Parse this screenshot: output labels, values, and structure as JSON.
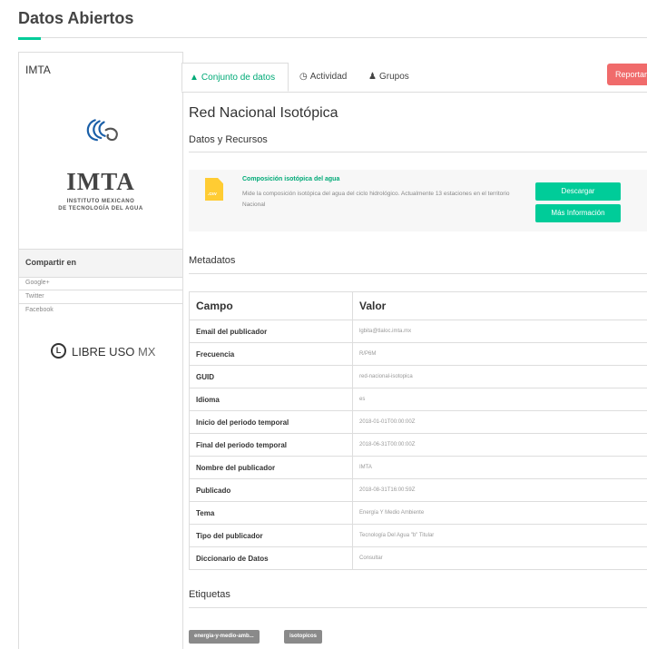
{
  "header": {
    "title": "Datos Abiertos"
  },
  "sidebar": {
    "org_name": "IMTA",
    "logo_text": "IMTA",
    "logo_subtitle_line1": "INSTITUTO MEXICANO",
    "logo_subtitle_line2": "DE TECNOLOGÍA DEL AGUA",
    "share_title": "Compartir en",
    "share_items": [
      "Google+",
      "Twitter",
      "Facebook"
    ],
    "libre_logo_letter": "L",
    "libre_logo_bold": "LIBRE USO",
    "libre_logo_light": " MX"
  },
  "tabs": [
    {
      "label": "Conjunto de datos",
      "icon": "sitemap-icon",
      "active": true
    },
    {
      "label": "Actividad",
      "icon": "clock-icon",
      "active": false
    },
    {
      "label": "Grupos",
      "icon": "users-icon",
      "active": false
    }
  ],
  "report_label": "Reportar",
  "dataset": {
    "title": "Red Nacional Isotópica",
    "resources_heading": "Datos y Recursos",
    "resource": {
      "format": ".csv",
      "title": "Composición isotópica del agua",
      "description": "Mide la composición isotópica del agua del ciclo hidrológico. Actualmente 13 estaciones en el territorio Nacional",
      "download_label": "Descargar",
      "more_info_label": "Más Información"
    },
    "metadata_heading": "Metadatos",
    "metadata_columns": [
      "Campo",
      "Valor"
    ],
    "metadata": [
      [
        "Email del publicador",
        "lgbita@tlaloc.imta.mx"
      ],
      [
        "Frecuencia",
        "R/P6M"
      ],
      [
        "GUID",
        "red-nacional-isotopica"
      ],
      [
        "Idioma",
        "es"
      ],
      [
        "Inicio del periodo temporal",
        "2018-01-01T00:00:00Z"
      ],
      [
        "Final del periodo temporal",
        "2018-06-31T00:00:00Z"
      ],
      [
        "Nombre del publicador",
        "IMTA"
      ],
      [
        "Publicado",
        "2018-08-31T16:00:59Z"
      ],
      [
        "Tema",
        "Energía Y Medio Ambiente"
      ],
      [
        "Tipo del publicador",
        "Tecnología Del Agua \"b\" Titular"
      ],
      [
        "Diccionario de Datos",
        "Consultar"
      ]
    ],
    "tags_heading": "Etiquetas",
    "tags": [
      "energia-y-medio-amb...",
      "isotopicos"
    ]
  },
  "colors": {
    "accent": "#00cc99",
    "report": "#f06b6b",
    "tag": "#8a8a8a",
    "csv": "#ffcc33"
  }
}
